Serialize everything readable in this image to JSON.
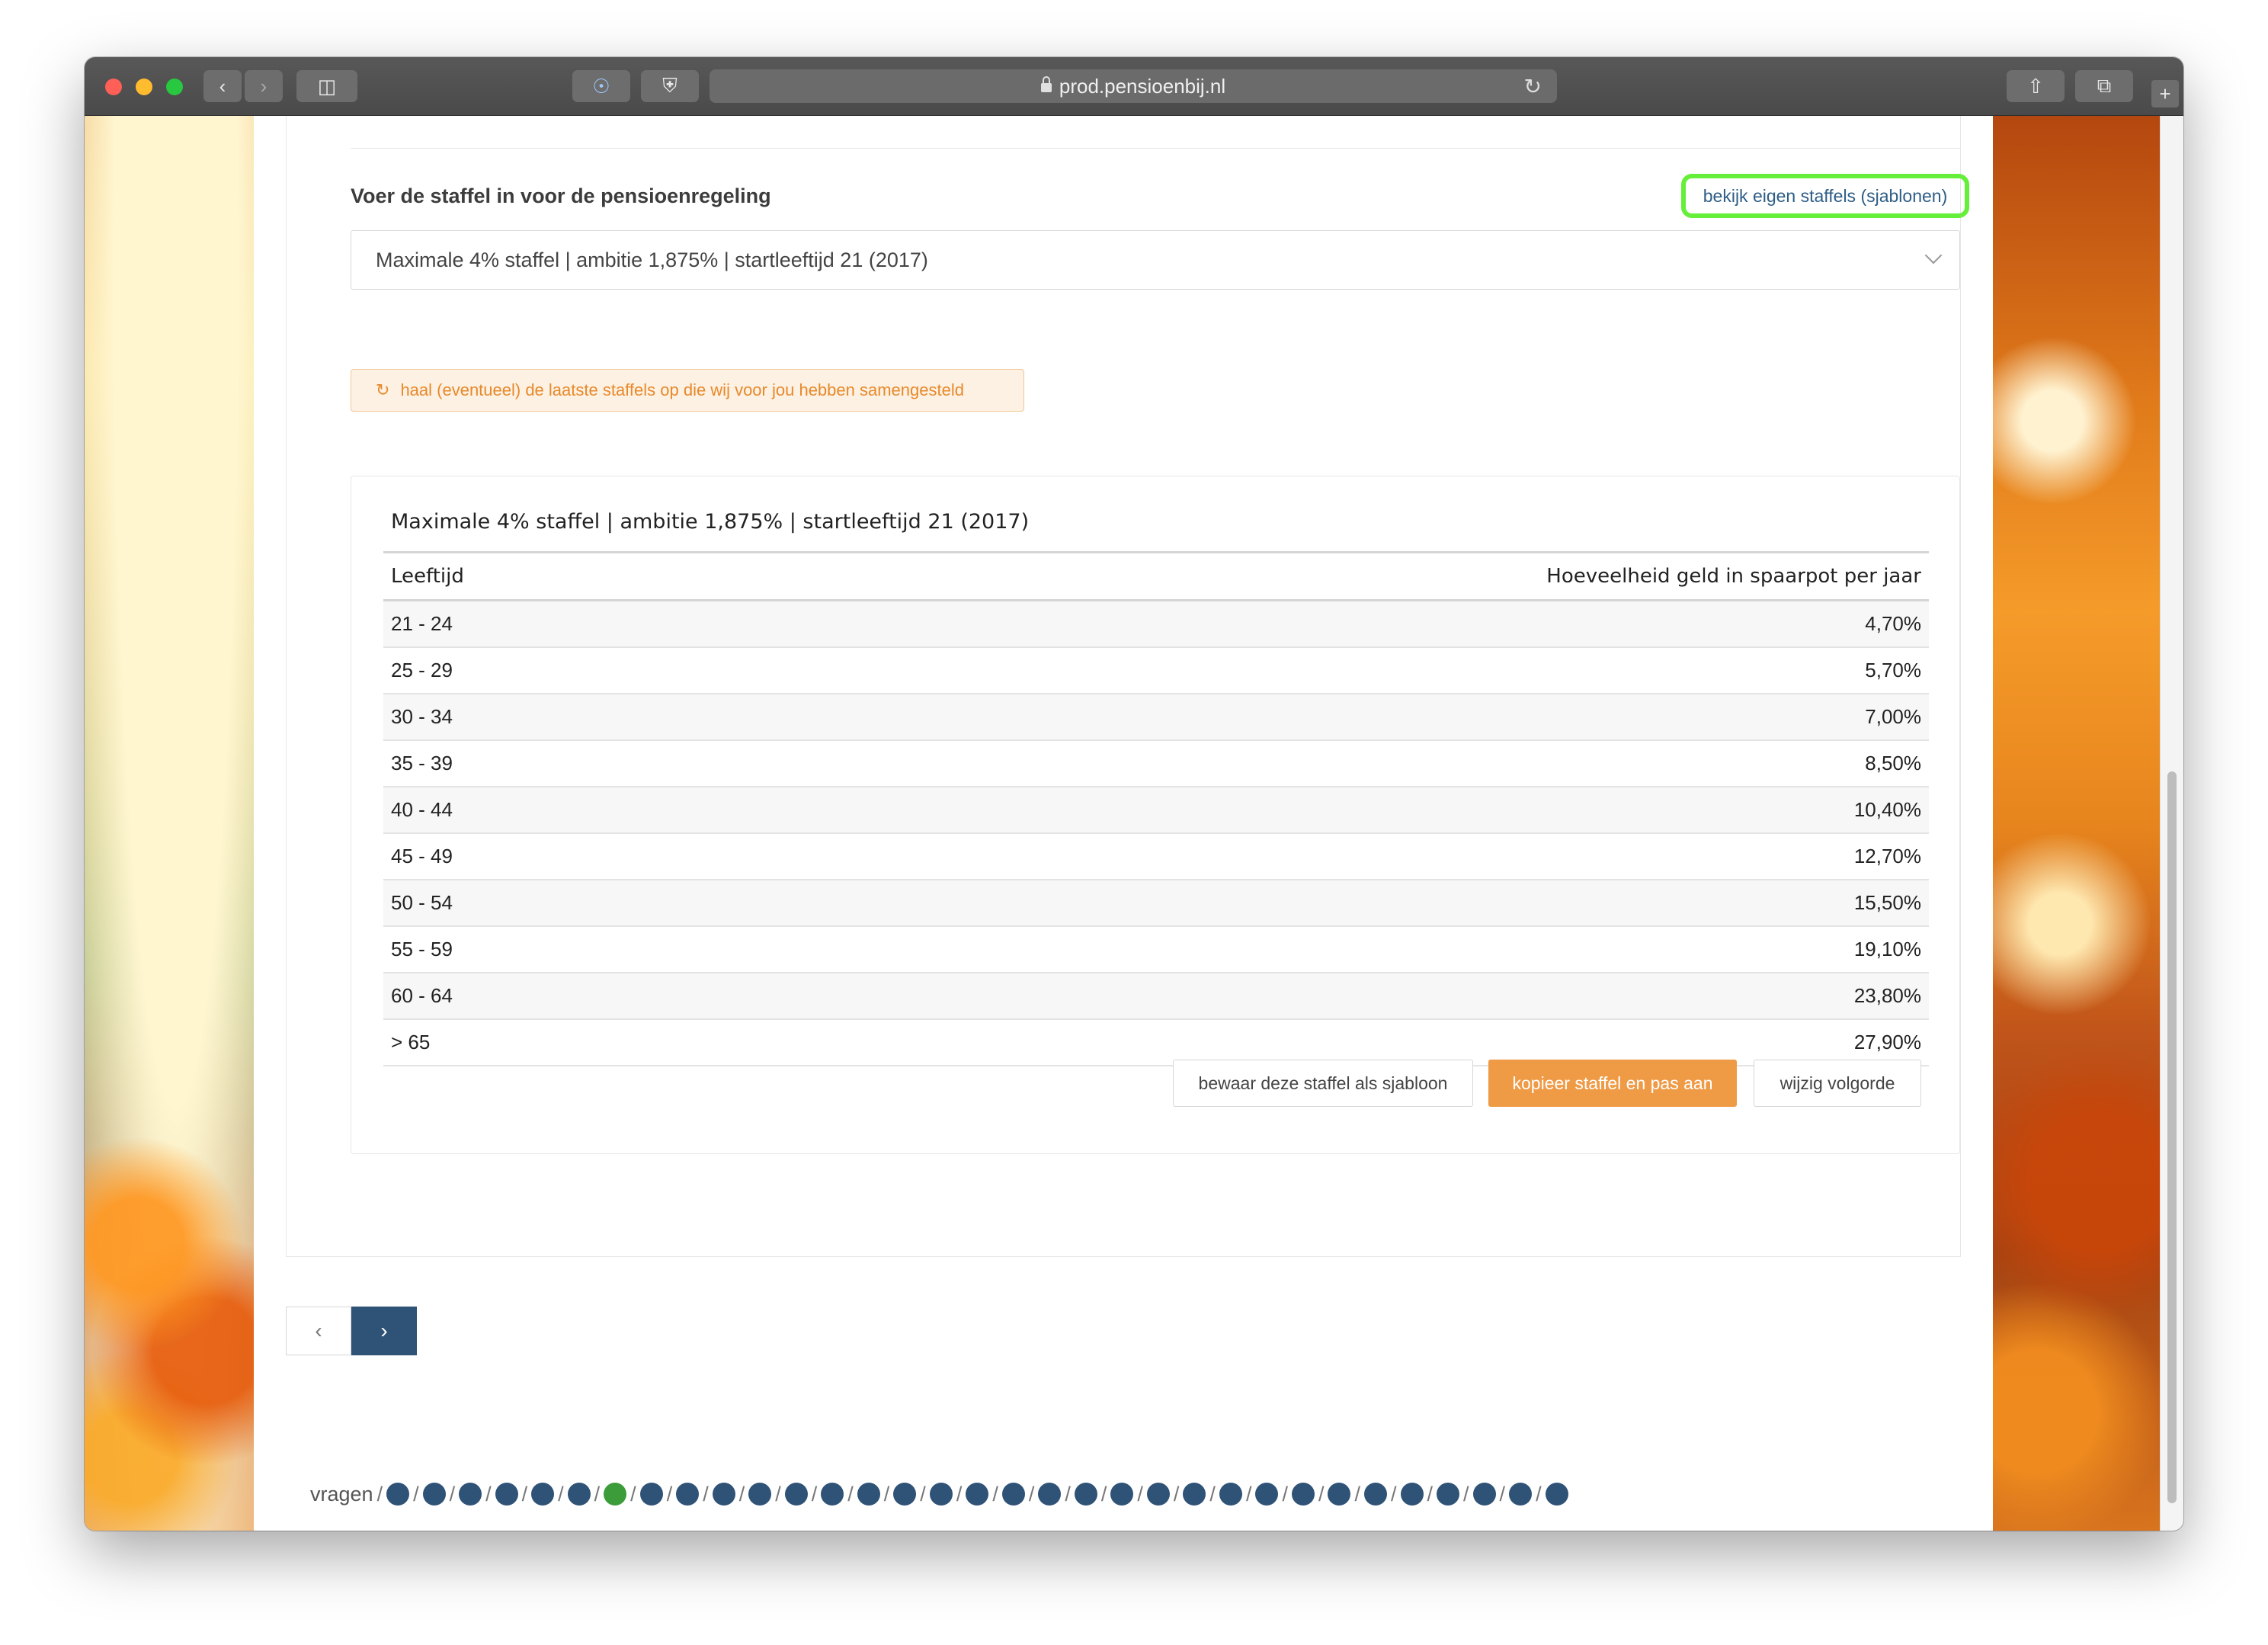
{
  "browser": {
    "url": "prod.pensioenbij.nl"
  },
  "question": {
    "label": "Voer de staffel in voor de pensioenregeling",
    "templates_link": "bekijk eigen staffels (sjablonen)",
    "select_value": "Maximale 4% staffel | ambitie 1,875% | startleeftijd 21 (2017)",
    "refresh_button": "haal (eventueel) de laatste staffels op die wij voor jou hebben samengesteld"
  },
  "table": {
    "title": "Maximale 4% staffel | ambitie 1,875% | startleeftijd 21 (2017)",
    "columns": [
      "Leeftijd",
      "Hoeveelheid geld in spaarpot per jaar"
    ],
    "rows": [
      [
        "21 - 24",
        "4,70%"
      ],
      [
        "25 - 29",
        "5,70%"
      ],
      [
        "30 - 34",
        "7,00%"
      ],
      [
        "35 - 39",
        "8,50%"
      ],
      [
        "40 - 44",
        "10,40%"
      ],
      [
        "45 - 49",
        "12,70%"
      ],
      [
        "50 - 54",
        "15,50%"
      ],
      [
        "55 - 59",
        "19,10%"
      ],
      [
        "60 - 64",
        "23,80%"
      ],
      [
        "> 65",
        "27,90%"
      ]
    ]
  },
  "actions": {
    "save_template": "bewaar deze staffel als sjabloon",
    "copy_edit": "kopieer staffel en pas aan",
    "change_order": "wijzig volgorde"
  },
  "pager": {
    "prev": "‹",
    "next": "›"
  },
  "progress": {
    "label": "vragen",
    "separator": "/",
    "total": 33,
    "current_index": 6
  },
  "colors": {
    "primary": "#2f5277",
    "accent_orange": "#ef9a45",
    "current_dot": "#3c9c3a",
    "highlight": "#66ef3a"
  }
}
